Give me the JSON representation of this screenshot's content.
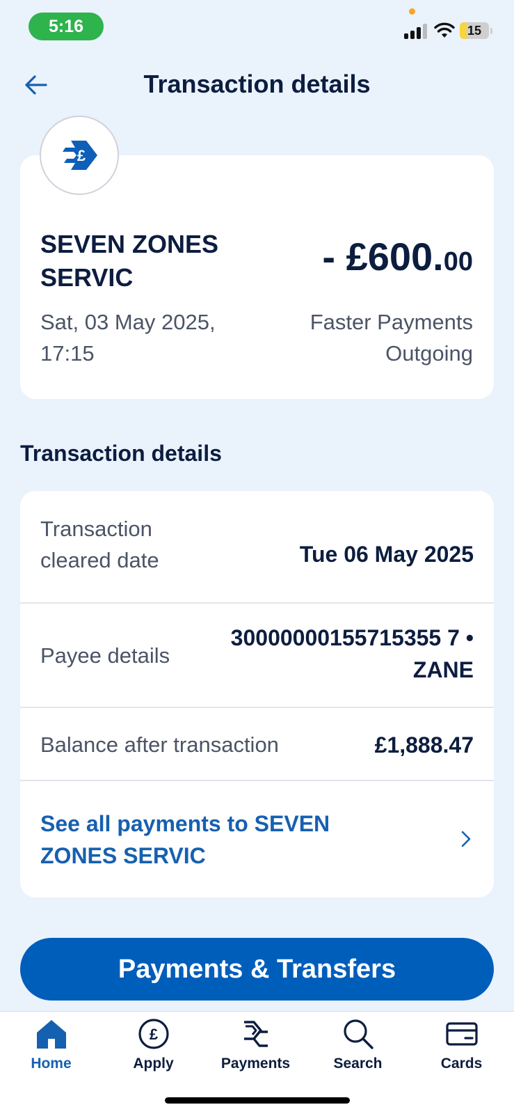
{
  "status_bar": {
    "time": "5:16",
    "battery": "15"
  },
  "header": {
    "title": "Transaction details",
    "back_icon": "arrow-left-icon"
  },
  "summary": {
    "merchant_icon": "faster-payment-pound-icon",
    "merchant": "SEVEN ZONES SERVIC",
    "date": "Sat, 03 May 2025, 17:15",
    "amount_main": "- £600.",
    "amount_cents": "00",
    "payment_type": "Faster Payments Outgoing"
  },
  "details": {
    "section_title": "Transaction details",
    "rows": [
      {
        "label": "Transaction cleared date",
        "value": "Tue 06 May 2025"
      },
      {
        "label": "Payee details",
        "value": "30000000155715355 7 • ZANE"
      },
      {
        "label": "Balance after transaction",
        "value": "£1,888.47"
      }
    ],
    "link": {
      "text": "See all payments to SEVEN ZONES SERVIC",
      "icon": "chevron-right-icon"
    }
  },
  "primary_button": "Payments & Transfers",
  "nav": [
    {
      "label": "Home",
      "icon": "home-icon",
      "active": true
    },
    {
      "label": "Apply",
      "icon": "pound-circle-icon",
      "active": false
    },
    {
      "label": "Payments",
      "icon": "payments-arrows-icon",
      "active": false
    },
    {
      "label": "Search",
      "icon": "search-icon",
      "active": false
    },
    {
      "label": "Cards",
      "icon": "card-icon",
      "active": false
    }
  ],
  "colors": {
    "background": "#eaf2fc",
    "primary": "#005ebb",
    "link": "#1660b0",
    "text": "#0c1d3f",
    "time_pill": "#2eb34d"
  }
}
